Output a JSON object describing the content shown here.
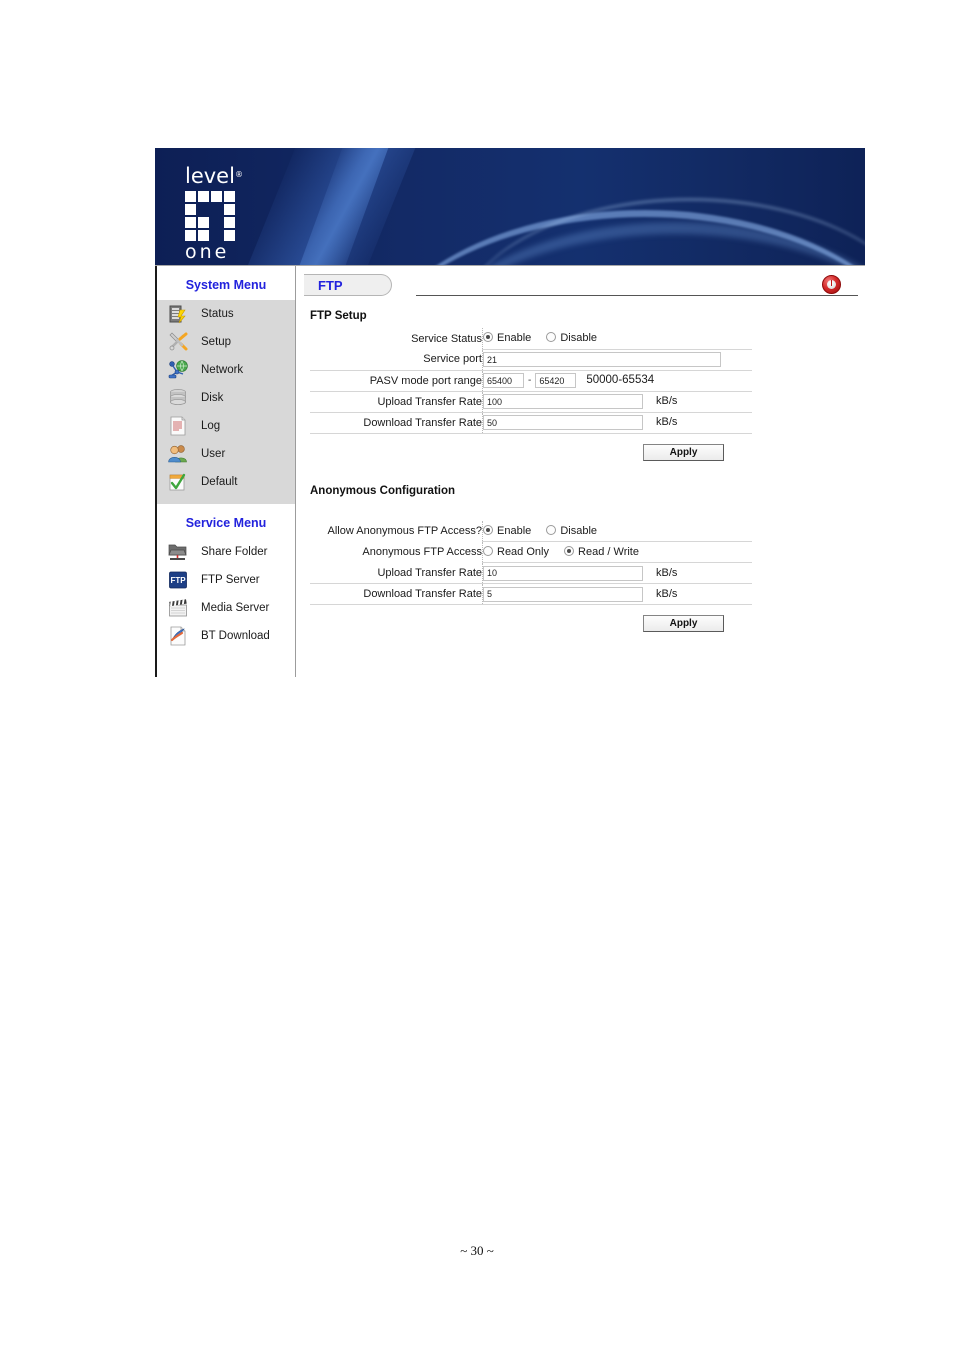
{
  "banner": {
    "logo_top": "level",
    "logo_registered": "®",
    "logo_bottom": "one"
  },
  "sidebar": {
    "system_menu_heading": "System Menu",
    "service_menu_heading": "Service Menu",
    "system_items": [
      {
        "label": "Status",
        "icon": "server-status-icon"
      },
      {
        "label": "Setup",
        "icon": "tools-icon"
      },
      {
        "label": "Network",
        "icon": "network-globe-icon"
      },
      {
        "label": "Disk",
        "icon": "disk-stack-icon"
      },
      {
        "label": "Log",
        "icon": "document-log-icon"
      },
      {
        "label": "User",
        "icon": "users-icon"
      },
      {
        "label": "Default",
        "icon": "checklist-icon"
      }
    ],
    "service_items": [
      {
        "label": "Share Folder",
        "icon": "folder-share-icon"
      },
      {
        "label": "FTP Server",
        "icon": "ftp-icon"
      },
      {
        "label": "Media Server",
        "icon": "clapperboard-icon"
      },
      {
        "label": "BT Download",
        "icon": "bt-download-icon"
      }
    ]
  },
  "header": {
    "tab_label": "FTP",
    "power_icon": "power-logout-icon"
  },
  "ftp_setup": {
    "title": "FTP Setup",
    "rows": {
      "service_status_label": "Service Status",
      "service_status_options": [
        "Enable",
        "Disable"
      ],
      "service_status_selected": "Enable",
      "service_port_label": "Service port",
      "service_port_value": "21",
      "pasv_label": "PASV mode port range",
      "pasv_from": "65400",
      "pasv_to": "65420",
      "pasv_separator": "-",
      "pasv_hint": "50000-65534",
      "upload_label": "Upload Transfer Rate",
      "upload_value": "100",
      "upload_unit": "kB/s",
      "download_label": "Download Transfer Rate",
      "download_value": "50",
      "download_unit": "kB/s"
    },
    "apply_label": "Apply"
  },
  "anonymous_config": {
    "title": "Anonymous Configuration",
    "rows": {
      "allow_label": "Allow Anonymous FTP Access?",
      "allow_options": [
        "Enable",
        "Disable"
      ],
      "allow_selected": "Enable",
      "access_label": "Anonymous FTP Access",
      "access_options": [
        "Read Only",
        "Read / Write"
      ],
      "access_selected": "Read / Write",
      "upload_label": "Upload Transfer Rate",
      "upload_value": "10",
      "upload_unit": "kB/s",
      "download_label": "Download Transfer Rate",
      "download_value": "5",
      "download_unit": "kB/s"
    },
    "apply_label": "Apply"
  },
  "footer": {
    "page_marker": "~ 30 ~"
  },
  "colors": {
    "banner_dark": "#0d1f55",
    "menu_heading_blue": "#2222dd",
    "tab_text_blue": "#2222dd",
    "power_red": "#d52a2a",
    "panel_grey": "#d8d8d8"
  }
}
